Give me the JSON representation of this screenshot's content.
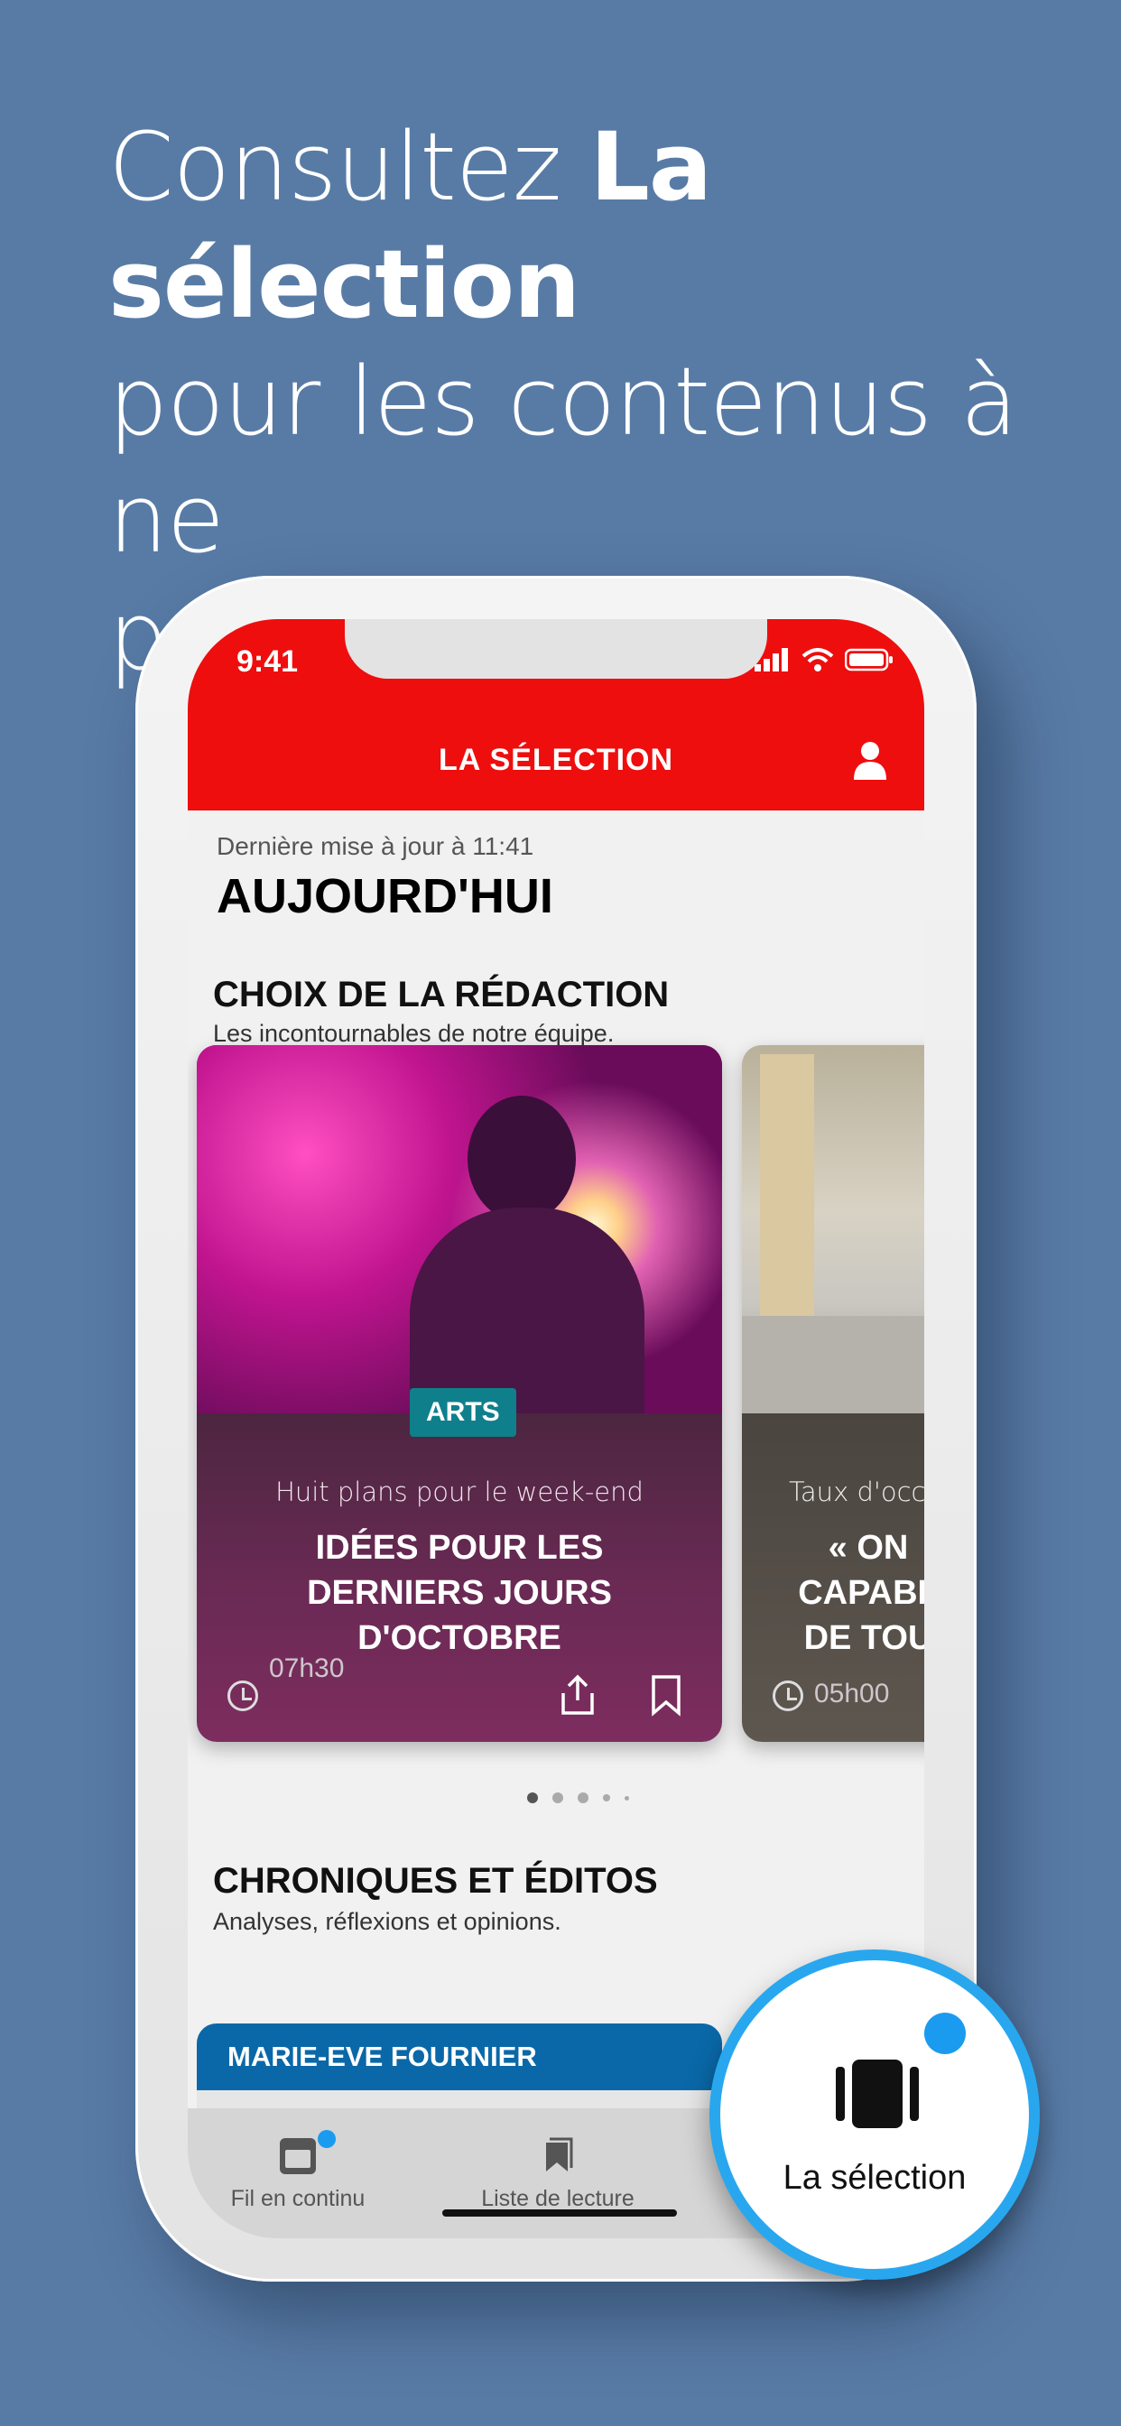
{
  "promo": {
    "line1_prefix": "Consultez ",
    "line1_bold": "La sélection",
    "line2": "pour les contenus à ne",
    "line3": "pas manquer"
  },
  "status_bar": {
    "time": "9:41"
  },
  "nav": {
    "title": "LA SÉLECTION",
    "profile_icon": "person-icon"
  },
  "header": {
    "updated": "Dernière mise à jour à 11:41",
    "title": "AUJOURD'HUI"
  },
  "section_editors": {
    "title": "CHOIX DE LA RÉDACTION",
    "subtitle": "Les incontournables de notre équipe.",
    "cards": [
      {
        "tag": "ARTS",
        "kicker": "Huit plans pour le week-end",
        "title": "IDÉES POUR LES DERNIERS JOURS D'OCTOBRE",
        "duration": "07h30"
      },
      {
        "kicker": "Taux d'occup",
        "title": "« ON CAPABL DE TOU",
        "duration": "05h00"
      }
    ]
  },
  "section_columns": {
    "title": "CHRONIQUES ET ÉDITOS",
    "subtitle": "Analyses, réflexions et opinions.",
    "cards": [
      {
        "author": "MARIE-EVE FOURNIER"
      }
    ]
  },
  "tabs": [
    {
      "label": "Fil en continu",
      "icon": "news-feed-icon"
    },
    {
      "label": "Liste de lecture",
      "icon": "bookmark-icon"
    },
    {
      "label": "La sélection",
      "icon": "selection-cards-icon"
    }
  ],
  "colors": {
    "background": "#587ba6",
    "brand_red": "#ee0e0e",
    "tag_teal": "#0f7f8c",
    "accent_blue": "#1b9bf0"
  }
}
